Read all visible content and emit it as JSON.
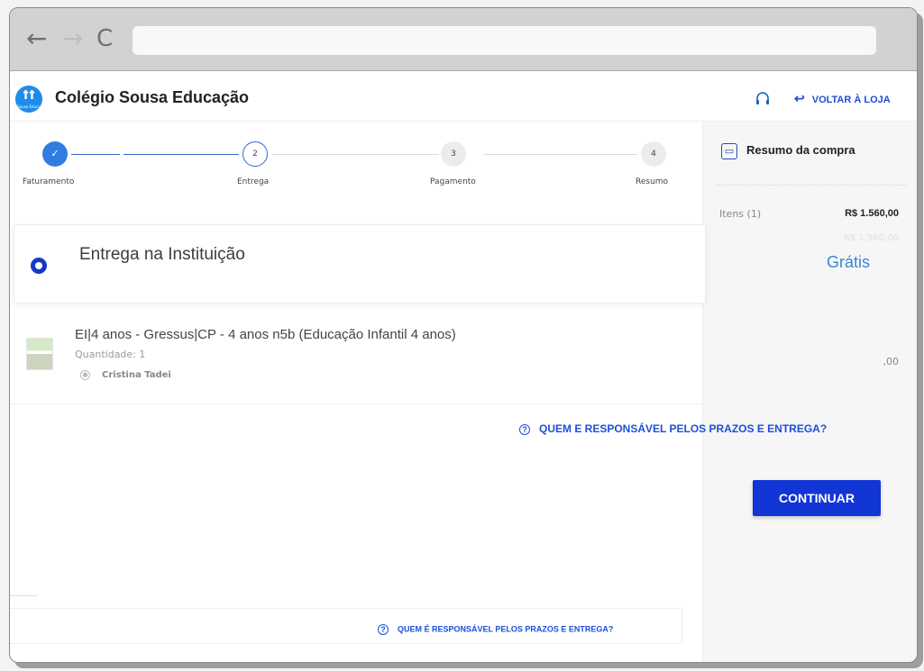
{
  "browser": {
    "back_glyph": "←",
    "forward_glyph": "→",
    "reload_glyph": "C"
  },
  "header": {
    "logo_text": "ꝉꝉ",
    "logo_sub": "Sousa Educa",
    "school_name": "Colégio Sousa Educação",
    "back_to_store": "VOLTAR À LOJA"
  },
  "stepper": {
    "steps": [
      {
        "number": "✓",
        "label": "Faturamento",
        "state": "done"
      },
      {
        "number": "2",
        "label": "Entrega",
        "state": "current"
      },
      {
        "number": "3",
        "label": "Pagamento",
        "state": "todo"
      },
      {
        "number": "4",
        "label": "Resumo",
        "state": "todo"
      }
    ]
  },
  "summary": {
    "title": "Resumo da compra",
    "items_label": "Itens (1)",
    "items_value": "R$ 1.560,00",
    "ghost_value": "R$ 1.560,00",
    "partial_value": ",00"
  },
  "delivery": {
    "option_title": "Entrega na Instituição",
    "price": "Grátis"
  },
  "product": {
    "name": "EI|4 anos - Gressus|CP - 4 anos n5b (Educação Infantil 4 anos)",
    "quantity": "Quantidade: 1",
    "student": "Cristina Tadei"
  },
  "links": {
    "help_upper": "QUEM E RESPONSÁVEL PELOS PRAZOS E ENTREGA?",
    "help_lower": "QUEM É RESPONSÁVEL PELOS PRAZOS E ENTREGA?"
  },
  "actions": {
    "continue": "CONTINUAR"
  },
  "colors": {
    "primary": "#1235d6",
    "link": "#1d4fd8",
    "step_done": "#2f7de1",
    "price": "#3a86d6"
  }
}
